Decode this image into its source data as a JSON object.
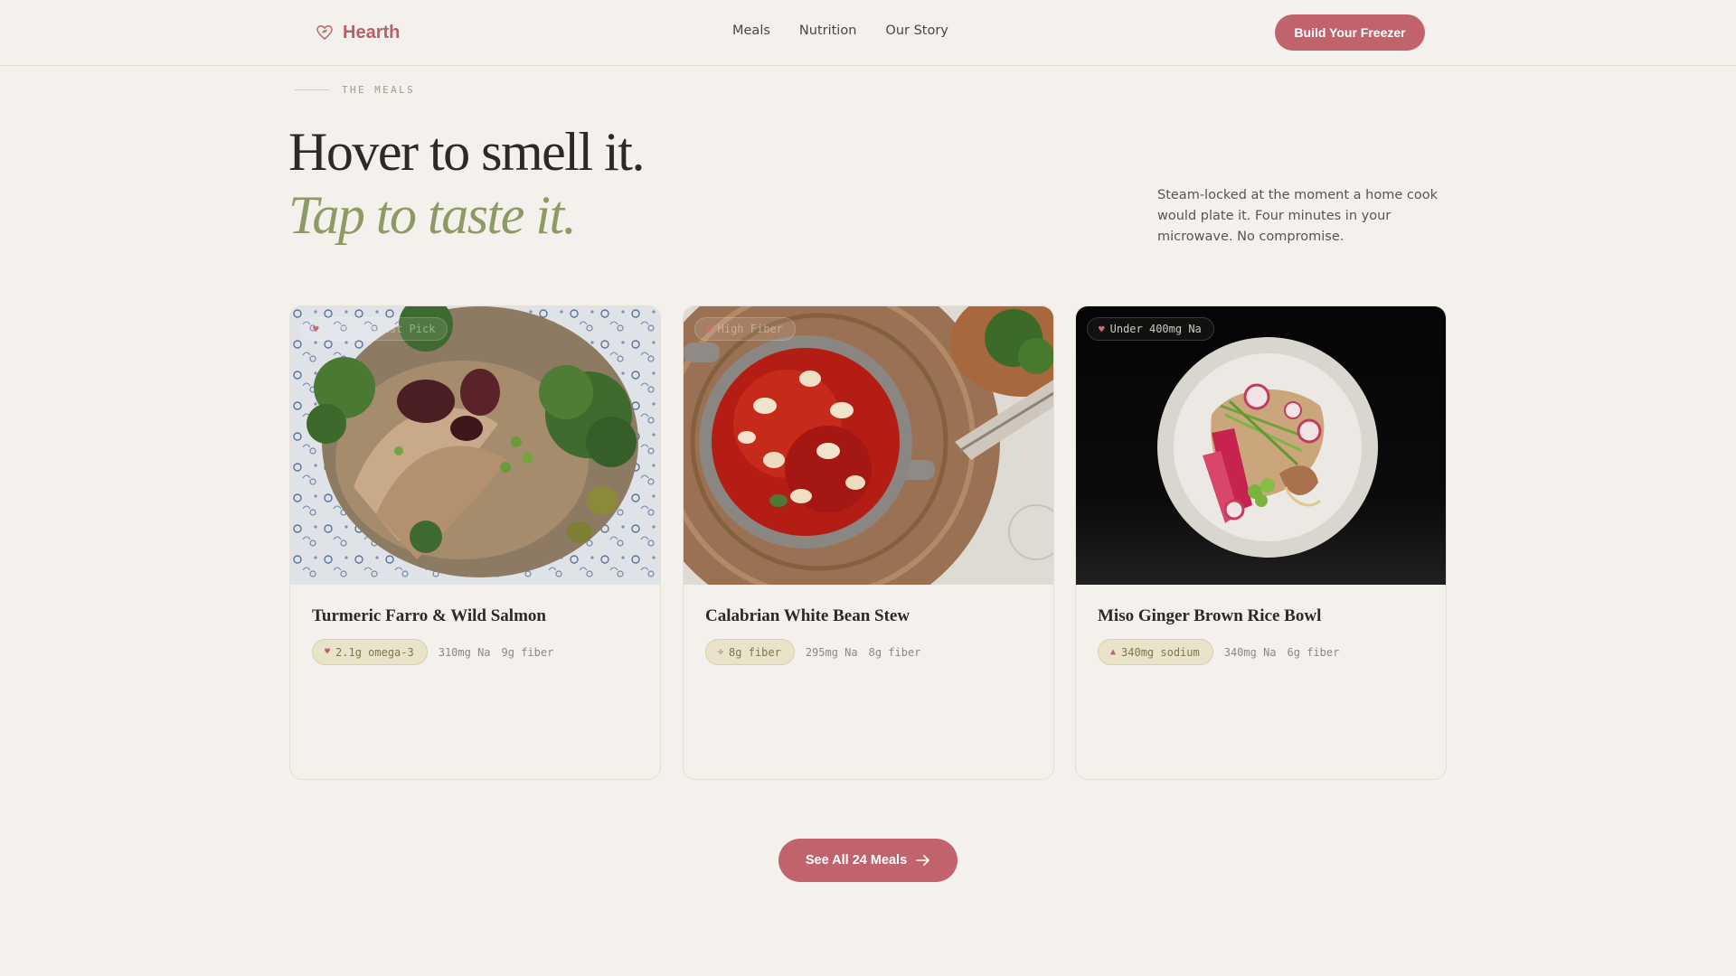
{
  "nav": {
    "brand": "Hearth",
    "links": [
      "Meals",
      "Nutrition",
      "Our Story"
    ],
    "cta": "Build Your Freezer"
  },
  "hero": {
    "eyebrow": "THE MEALS",
    "headline": "Hover to smell it.",
    "headline_italic": "Tap to taste it.",
    "lede": "Steam-locked at the moment a home cook would plate it. Four minutes in your microwave. No compromise."
  },
  "meals": [
    {
      "title": "Turmeric Farro & Wild Salmon",
      "badge": "Cardiologist Pick",
      "highlight": "2.1g omega-3",
      "highlight_icon": "heart-icon",
      "sodium": "310mg Na",
      "fiber": "9g fiber"
    },
    {
      "title": "Calabrian White Bean Stew",
      "badge": "High Fiber",
      "highlight": "8g fiber",
      "highlight_icon": "sprout-icon",
      "sodium": "295mg Na",
      "fiber": "8g fiber"
    },
    {
      "title": "Miso Ginger Brown Rice Bowl",
      "badge": "Under 400mg Na",
      "highlight": "340mg sodium",
      "highlight_icon": "salt-icon",
      "sodium": "340mg Na",
      "fiber": "6g fiber"
    }
  ],
  "footer_cta": "See All 24 Meals",
  "colors": {
    "accent": "#c0636d",
    "olive": "#8e9a64",
    "background": "#f4f0eb",
    "pill_bg": "#e9e3c9"
  }
}
